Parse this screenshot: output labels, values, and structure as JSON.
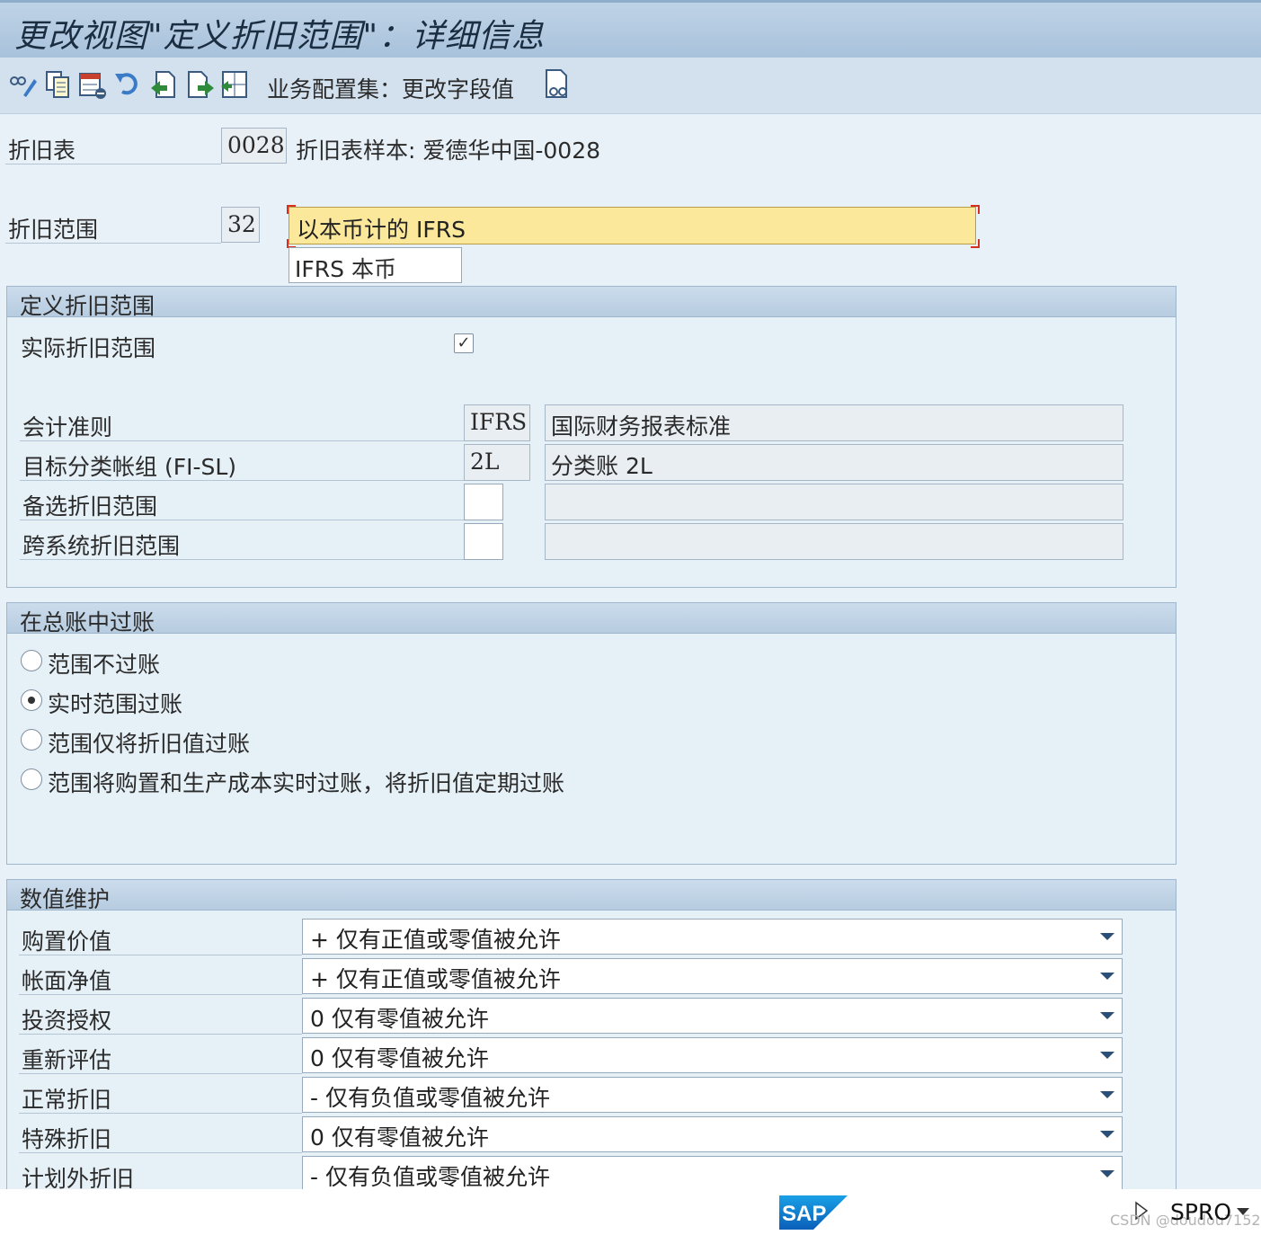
{
  "window": {
    "title": "更改视图\"定义折旧范围\"：详细信息"
  },
  "toolbar": {
    "icons": [
      "display-change-icon",
      "copy-icon",
      "delete-icon",
      "undo-icon",
      "previous-entry-icon",
      "next-entry-icon",
      "select-icon",
      "bc-set-icon"
    ],
    "bc_set_label": "业务配置集：更改字段值"
  },
  "header_fields": {
    "chart_label": "折旧表",
    "chart_value": "0028",
    "chart_desc": "折旧表样本: 爱德华中国-0028",
    "area_label": "折旧范围",
    "area_value": "32",
    "area_name": "以本币计的 IFRS",
    "area_short": "IFRS 本币"
  },
  "define_group": {
    "title": "定义折旧范围",
    "real_area_label": "实际折旧范围",
    "real_area_checked": true,
    "rows": [
      {
        "label": "会计准则",
        "code": "IFRS",
        "desc": "国际财务报表标准"
      },
      {
        "label": "目标分类帐组 (FI-SL)",
        "code": "2L",
        "desc": "分类账 2L"
      },
      {
        "label": "备选折旧范围",
        "code": "",
        "desc": ""
      },
      {
        "label": "跨系统折旧范围",
        "code": "",
        "desc": ""
      }
    ]
  },
  "posting_group": {
    "title": "在总账中过账",
    "options": [
      {
        "label": "范围不过账",
        "selected": false
      },
      {
        "label": "实时范围过账",
        "selected": true
      },
      {
        "label": "范围仅将折旧值过账",
        "selected": false
      },
      {
        "label": "范围将购置和生产成本实时过账，将折旧值定期过账",
        "selected": false
      }
    ]
  },
  "value_group": {
    "title": "数值维护",
    "rows": [
      {
        "label": "购置价值",
        "value": "+ 仅有正值或零值被允许"
      },
      {
        "label": "帐面净值",
        "value": "+ 仅有正值或零值被允许"
      },
      {
        "label": "投资授权",
        "value": "0 仅有零值被允许"
      },
      {
        "label": "重新评估",
        "value": "0 仅有零值被允许"
      },
      {
        "label": "正常折旧",
        "value": "- 仅有负值或零值被允许"
      },
      {
        "label": "特殊折旧",
        "value": "0 仅有零值被允许"
      },
      {
        "label": "计划外折旧",
        "value": "- 仅有负值或零值被允许"
      }
    ]
  },
  "status": {
    "logo": "SAP",
    "system": "SPRO",
    "watermark": "CSDN @doudou7152"
  },
  "colors": {
    "title_bg": "#b4cbe1",
    "focus_bg": "#fbe89a",
    "group_header": "#c3d6e8",
    "sap_blue": "#0a71c7"
  }
}
